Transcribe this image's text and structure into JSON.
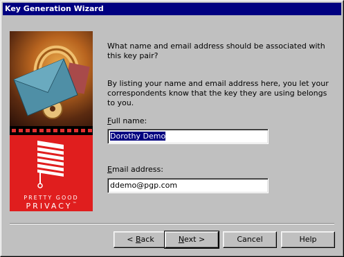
{
  "window": {
    "title": "Key Generation Wizard"
  },
  "art": {
    "brand_line1": "PRETTY GOOD",
    "brand_line2": "PRIVACY",
    "trademark": "™"
  },
  "content": {
    "question": "What name and email address should be associated with this key pair?",
    "explanation": "By listing your name and email address here, you let your correspondents know that the key they are using belongs to you.",
    "full_name_label": "Full name:",
    "full_name_value": "Dorothy Demo",
    "email_label": "Email address:",
    "email_value": "ddemo@pgp.com"
  },
  "buttons": {
    "back": "< Back",
    "next": "Next >",
    "cancel": "Cancel",
    "help": "Help"
  }
}
